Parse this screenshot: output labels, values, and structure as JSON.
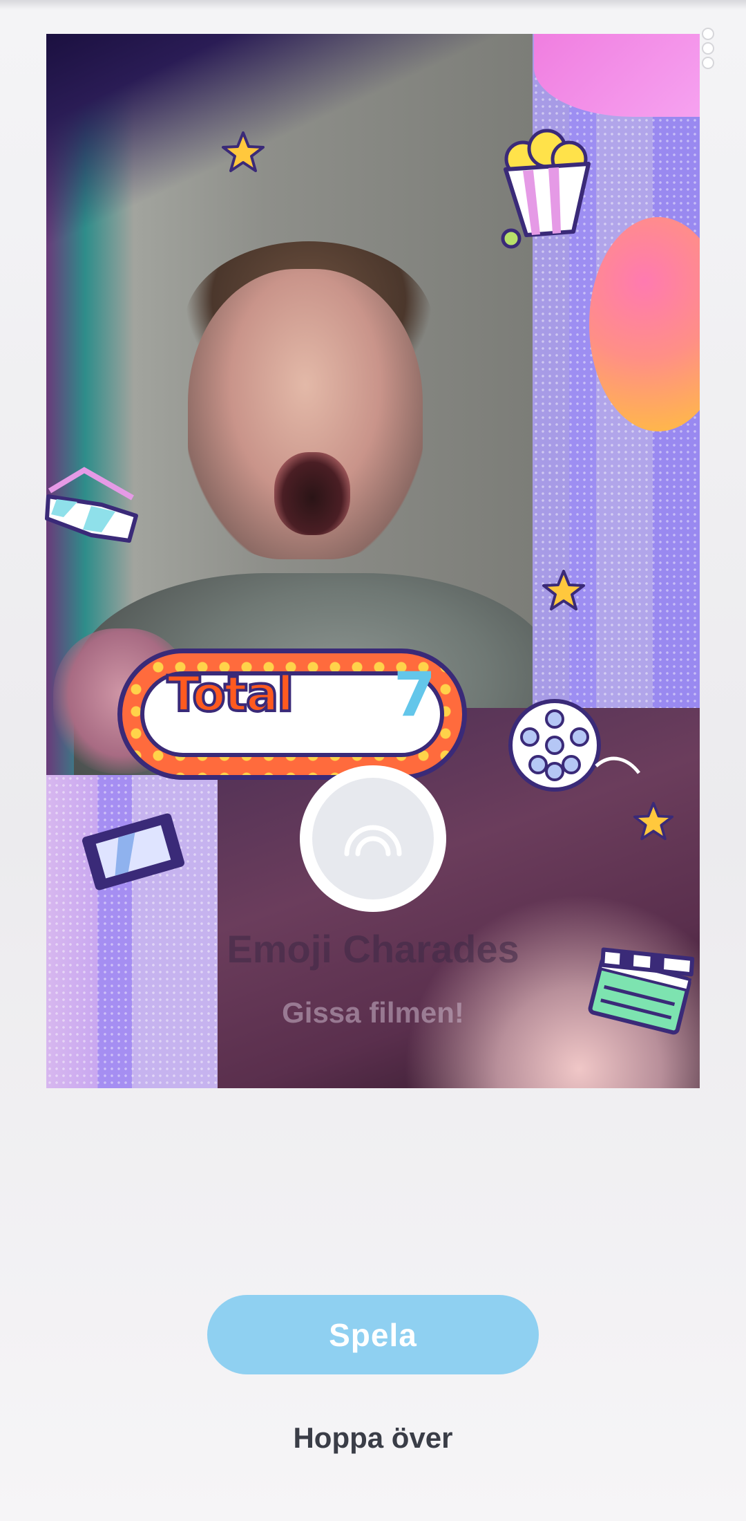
{
  "preview": {
    "score_label": "Total",
    "score_value": "7"
  },
  "app": {
    "title": "Emoji Charades",
    "subtitle": "Gissa filmen!",
    "icon": "rainbow-icon"
  },
  "actions": {
    "play_label": "Spela",
    "skip_label": "Hoppa över"
  },
  "colors": {
    "play_button": "#8fd0f1",
    "marquee_frame": "#ff6b3d",
    "marquee_text": "#ff5a1f",
    "score_text": "#63c6ea"
  }
}
